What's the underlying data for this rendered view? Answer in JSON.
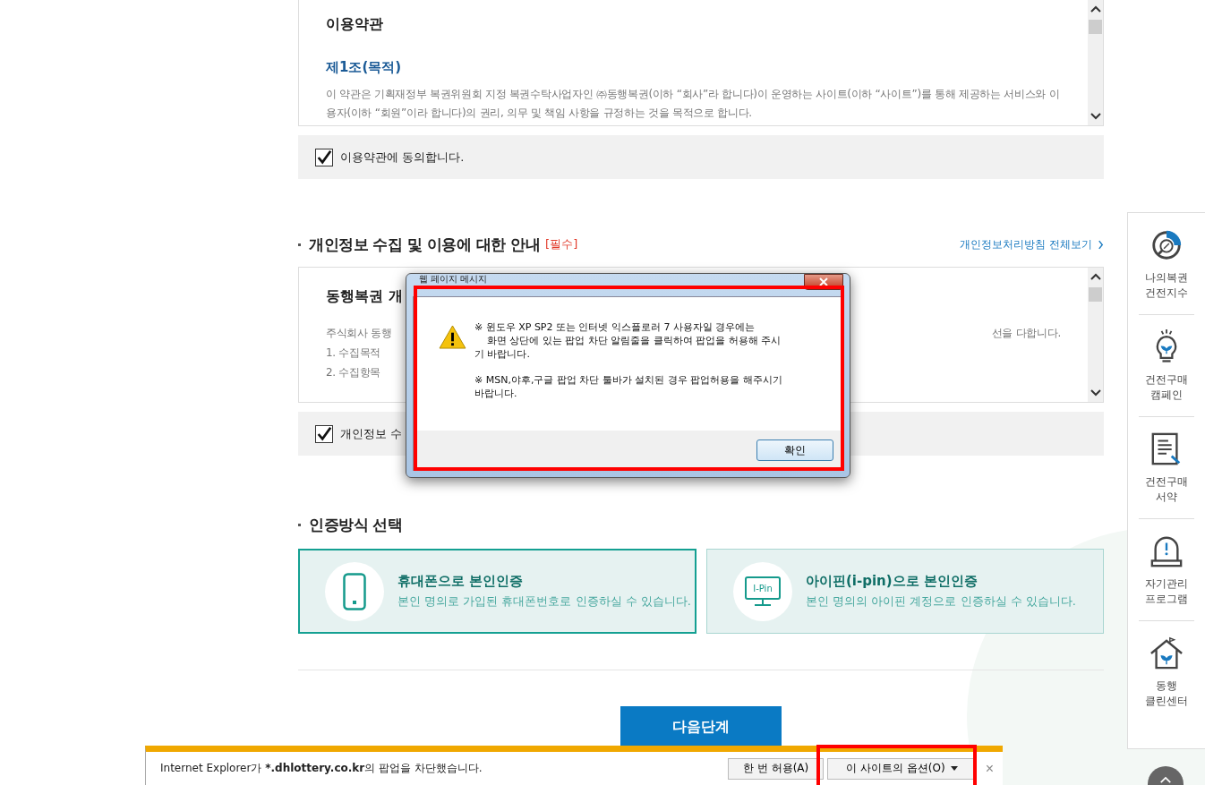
{
  "terms": {
    "title": "이용약관",
    "article": "제1조(목적)",
    "text": "이 약관은 기획재정부 복권위원회 지정 복권수탁사업자인 ㈜동행복권(이하 “회사”라 합니다)이 운영하는 사이트(이하 “사이트”)를 통해 제공하는 서비스와 이용자(이하 “회원”이라 합니다)의 권리, 의무 및 책임 사항을 규정하는 것을 목적으로 합니다.",
    "agree": {
      "label": "이용약관에 동의합니다.",
      "checked": true
    }
  },
  "privacy": {
    "heading": "개인정보 수집 및 이용에 대한 안내",
    "tag": "[필수]",
    "link": "개인정보처리방침 전체보기",
    "title": "동행복권 개",
    "intro_start": "주식회사 동행",
    "intro_end": "선을 다합니다.",
    "items": [
      "1. 수집목적",
      "2. 수집항목"
    ],
    "agree": {
      "label": "개인정보 수",
      "checked": true
    }
  },
  "auth": {
    "heading": "인증방식 선택",
    "methods": [
      {
        "kind": "phone",
        "title": "휴대폰으로 본인인증",
        "desc": "본인 명의로 가입된 휴대폰번호로 인증하실 수 있습니다.",
        "selected": true
      },
      {
        "kind": "ipin",
        "icon_text": "I-Pin",
        "title": "아이핀(i-pin)으로 본인인증",
        "desc": "본인 명의의 아이핀 계정으로 인증하실 수 있습니다.",
        "selected": false
      }
    ]
  },
  "next_button": "다음단계",
  "sidebar": [
    {
      "kind": "gauge",
      "label": "나의복권 건전지수"
    },
    {
      "kind": "bulb",
      "label": "건전구매 캠페인"
    },
    {
      "kind": "doc",
      "label": "건전구매 서약"
    },
    {
      "kind": "alarm",
      "label": "자기관리 프로그램"
    },
    {
      "kind": "house",
      "label": "동행 클린센터"
    }
  ],
  "dialog": {
    "title": "웹 페이지 메시지",
    "paragraphs": [
      [
        "※ 윈도우 XP SP2 또는 인터넷 익스플로러 7 사용자일 경우에는",
        "    화면 상단에 있는 팝업 차단 알림줄을 클릭하여 팝업을 허용해 주시",
        "기 바랍니다."
      ],
      [
        "※ MSN,야후,구글 팝업 차단 툴바가 설치된 경우 팝업허용을 해주시기",
        "바랍니다."
      ]
    ],
    "ok": "확인"
  },
  "ie_bar": {
    "before": "Internet Explorer가 ",
    "domain": "*.dhlottery.co.kr",
    "after": "의 팝업을 차단했습니다.",
    "allow": "한 번 허용(A)",
    "options": "이 사이트의 옵션(O)",
    "close": "×"
  }
}
